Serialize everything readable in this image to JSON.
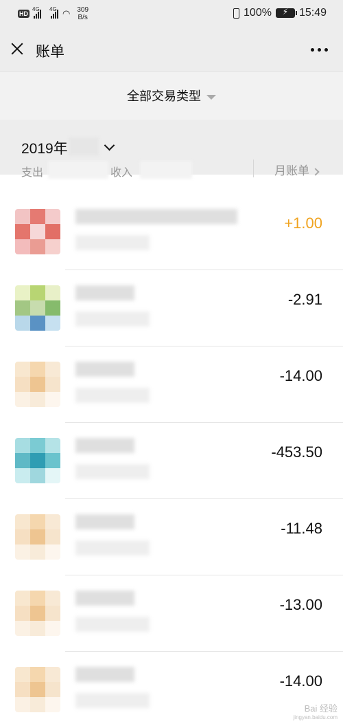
{
  "status_bar": {
    "hd_badge": "HD",
    "signal1_label": "4G",
    "signal2_label": "4G",
    "net_speed_value": "309",
    "net_speed_unit": "B/s",
    "battery_percent": "100%",
    "time": "15:49"
  },
  "nav": {
    "title": "账单",
    "close_icon": "close-icon",
    "more_icon": "more-icon"
  },
  "filter": {
    "label": "全部交易类型"
  },
  "month_summary": {
    "month_label": "2019年",
    "expense_label": "支出",
    "income_label": "收入",
    "monthly_bill_label": "月账单"
  },
  "transactions": [
    {
      "amount": "+1.00",
      "positive": true,
      "colors": [
        "#f2c4c4",
        "#e57a72",
        "#f4cbcb",
        "#e4756c",
        "#f6d8d8",
        "#e26f66",
        "#f3bcbc",
        "#ea9c93",
        "#f6d0cd"
      ]
    },
    {
      "amount": "-2.91",
      "positive": false,
      "colors": [
        "#e9f2c6",
        "#b8d573",
        "#e8f0c8",
        "#a3c784",
        "#c7dcae",
        "#86bb6c",
        "#b9d8ea",
        "#5a92c4",
        "#c6e0f0"
      ]
    },
    {
      "amount": "-14.00",
      "positive": false,
      "colors": [
        "#f8e7cf",
        "#f5d7ae",
        "#f8e9d5",
        "#f6dfc2",
        "#eec591",
        "#f6e4cc",
        "#fbf1e4",
        "#f8ebd9",
        "#fdf6ee"
      ]
    },
    {
      "amount": "-453.50",
      "positive": false,
      "colors": [
        "#a7dde2",
        "#7bcbd3",
        "#b5e3e7",
        "#5fb9c6",
        "#2f9db3",
        "#6ac3cd",
        "#c9ecef",
        "#9fd7de",
        "#e4f6f7"
      ]
    },
    {
      "amount": "-11.48",
      "positive": false,
      "colors": [
        "#f8e7cf",
        "#f5d7ae",
        "#f8e9d5",
        "#f6dfc2",
        "#eec591",
        "#f6e4cc",
        "#fbf1e4",
        "#f8ebd9",
        "#fdf6ee"
      ]
    },
    {
      "amount": "-13.00",
      "positive": false,
      "colors": [
        "#f8e7cf",
        "#f5d7ae",
        "#f8e9d5",
        "#f6dfc2",
        "#eec591",
        "#f6e4cc",
        "#fbf1e4",
        "#f8ebd9",
        "#fdf6ee"
      ]
    },
    {
      "amount": "-14.00",
      "positive": false,
      "colors": [
        "#f8e7cf",
        "#f5d7ae",
        "#f8e9d5",
        "#f6dfc2",
        "#eec591",
        "#f6e4cc",
        "#fbf1e4",
        "#f8ebd9",
        "#fdf6ee"
      ]
    }
  ],
  "colors": {
    "positive_amount": "#f0a31f",
    "header_bg": "#ededed"
  },
  "watermark": {
    "text": "Bai 经验",
    "url": "jingyan.baidu.com"
  }
}
